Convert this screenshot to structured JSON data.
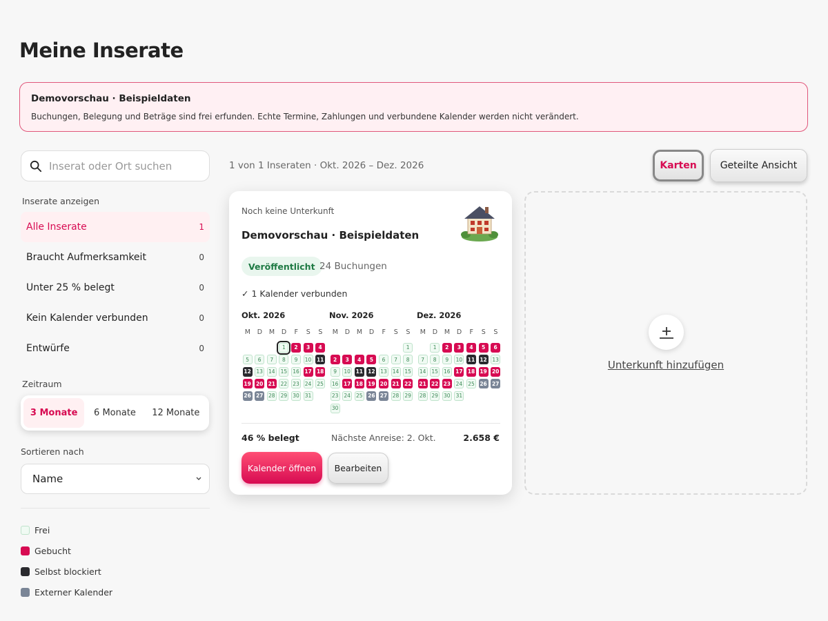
{
  "page": {
    "title": "Meine Inserate"
  },
  "banner": {
    "title": "Demovorschau · Beispieldaten",
    "text": "Buchungen, Belegung und Beträge sind frei erfunden. Echte Termine, Zahlungen und verbundene Kalender werden nicht verändert."
  },
  "search": {
    "placeholder": "Inserat oder Ort suchen",
    "icon": "search-icon"
  },
  "filters": {
    "heading": "Inserate anzeigen",
    "items": [
      {
        "label": "Alle Inserate",
        "count": "1",
        "active": true
      },
      {
        "label": "Braucht Aufmerksamkeit",
        "count": "0"
      },
      {
        "label": "Unter 25 % belegt",
        "count": "0"
      },
      {
        "label": "Kein Kalender verbunden",
        "count": "0"
      },
      {
        "label": "Entwürfe",
        "count": "0"
      }
    ]
  },
  "range": {
    "heading": "Zeitraum",
    "options": [
      "3 Monate",
      "6 Monate",
      "12 Monate"
    ],
    "selected": "3 Monate"
  },
  "sort": {
    "heading": "Sortieren nach",
    "value": "Name"
  },
  "legend": [
    {
      "label": "Frei",
      "color": "#f0faf3"
    },
    {
      "label": "Gebucht",
      "color": "#d70b52"
    },
    {
      "label": "Selbst blockiert",
      "color": "#2a2a2e"
    },
    {
      "label": "Externer Kalender",
      "color": "#7a8596"
    }
  ],
  "summary": "1 von 1 Inseraten · Okt. 2026 – Dez. 2026",
  "view": {
    "cards": "Karten",
    "split": "Geteilte Ansicht",
    "active": "Karten"
  },
  "card": {
    "subtitle": "Noch keine Unterkunft",
    "title": "Demovorschau · Beispieldaten",
    "image": "house-illustration",
    "status": "Veröffentlicht",
    "bookings": "24 Buchungen",
    "calendar_connected": "✓  1 Kalender verbunden",
    "weekdays": [
      "M",
      "D",
      "M",
      "D",
      "F",
      "S",
      "S"
    ],
    "months": [
      {
        "title": "Okt. 2026",
        "offset": 3,
        "today": 1,
        "booked": [
          2,
          3,
          4,
          17,
          18,
          19,
          20,
          21
        ],
        "blocked": [
          11,
          12
        ],
        "external": [
          26,
          27
        ],
        "days": 31
      },
      {
        "title": "Nov. 2026",
        "offset": 6,
        "booked": [
          2,
          3,
          4,
          5,
          17,
          18,
          19,
          20,
          21,
          22
        ],
        "blocked": [
          11,
          12
        ],
        "external": [
          26,
          27
        ],
        "days": 30
      },
      {
        "title": "Dez. 2026",
        "offset": 1,
        "booked": [
          2,
          3,
          4,
          5,
          6,
          17,
          18,
          19,
          20,
          21,
          22,
          23
        ],
        "blocked": [
          11,
          12
        ],
        "external": [
          26,
          27
        ],
        "days": 31
      }
    ],
    "occupancy": "46 % belegt",
    "next_arrival": "Nächste Anreise: 2. Okt.",
    "amount": "2.658 €",
    "open_label": "Kalender öffnen",
    "edit_label": "Bearbeiten"
  },
  "add": {
    "label": "Unterkunft hinzufügen",
    "icon": "plus-icon"
  },
  "colors": {
    "accent": "#d70b52",
    "published": "#1f7a44"
  }
}
